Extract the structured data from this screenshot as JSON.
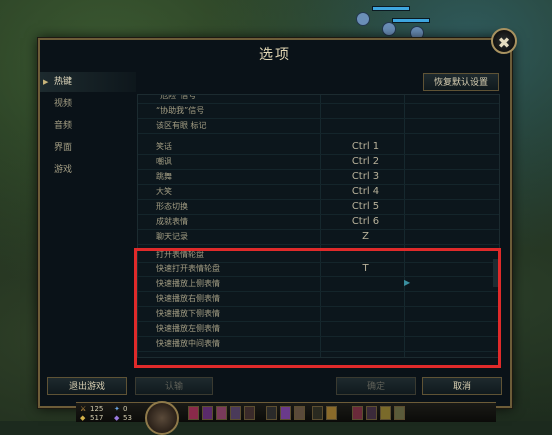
{
  "dialog": {
    "title": "选项",
    "close_label": "✖"
  },
  "sidebar": {
    "items": [
      {
        "label": "热键",
        "active": true
      },
      {
        "label": "视频",
        "active": false
      },
      {
        "label": "音频",
        "active": false
      },
      {
        "label": "界面",
        "active": false
      },
      {
        "label": "游戏",
        "active": false
      }
    ]
  },
  "restore_defaults_label": "恢复默认设置",
  "hotkey_rows": [
    {
      "label": "“危险”信号",
      "key": ""
    },
    {
      "label": "“协助我”信号",
      "key": ""
    },
    {
      "label": "该区有眼 标记",
      "key": ""
    },
    {
      "label": "笑话",
      "key": "Ctrl 1"
    },
    {
      "label": "嘲讽",
      "key": "Ctrl 2"
    },
    {
      "label": "跳舞",
      "key": "Ctrl 3"
    },
    {
      "label": "大笑",
      "key": "Ctrl 4"
    },
    {
      "label": "形态切换",
      "key": "Ctrl 5"
    },
    {
      "label": "成就表情",
      "key": "Ctrl 6"
    },
    {
      "label": "聊天记录",
      "key": "Z"
    },
    {
      "label": "打开表情轮盘",
      "key": ""
    },
    {
      "label": "快速打开表情轮盘",
      "key": "T"
    },
    {
      "label": "快速播放上侧表情",
      "key": ""
    },
    {
      "label": "快速播放右侧表情",
      "key": ""
    },
    {
      "label": "快速播放下侧表情",
      "key": ""
    },
    {
      "label": "快速播放左侧表情",
      "key": ""
    },
    {
      "label": "快速播放中间表情",
      "key": ""
    }
  ],
  "footer": {
    "exit_game_label": "退出游戏",
    "surrender_label": "认输",
    "confirm_label": "确定",
    "cancel_label": "取消"
  },
  "hud": {
    "ad": "125",
    "ap": "0",
    "armor": "517",
    "mr": "53"
  },
  "colors": {
    "highlight": "#e02a2a",
    "gold_border": "#6d5c38",
    "panel_bg": "#0a1218"
  }
}
